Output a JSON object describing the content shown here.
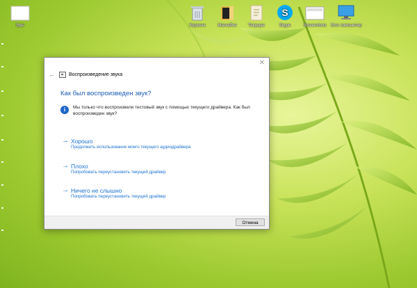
{
  "desktop": {
    "icons": [
      {
        "label": "Эрег",
        "icon": "blank-document-icon"
      },
      {
        "label": "Корзина",
        "icon": "recycle-bin-icon"
      },
      {
        "label": "Маткабое",
        "icon": "folder-icon"
      },
      {
        "label": "Текущее",
        "icon": "document-icon"
      },
      {
        "label": "Skype",
        "icon": "skype-icon"
      },
      {
        "label": "Screenshots",
        "icon": "screenshot-icon"
      },
      {
        "label": "Этот компьютер",
        "icon": "this-pc-icon"
      }
    ]
  },
  "dialog": {
    "title": "Воспроизведение звука",
    "heading": "Как был воспроизведен звук?",
    "info": "Мы только что воспроизвели тестовый звук с помощью текущего драйвера. Как был воспроизведен звук?",
    "options": [
      {
        "title": "Хорошо",
        "subtitle": "Продолжить использование моего текущего аудиодрайвера"
      },
      {
        "title": "Плохо",
        "subtitle": "Попробовать переустановить текущий драйвер"
      },
      {
        "title": "Ничего не слышно",
        "subtitle": "Попробовать переустановить текущий драйвер"
      }
    ],
    "cancel": "Отмена"
  },
  "colors": {
    "accent": "#1a70d0",
    "heading": "#1a5bb5",
    "wallpaper": "#b6d94a"
  }
}
